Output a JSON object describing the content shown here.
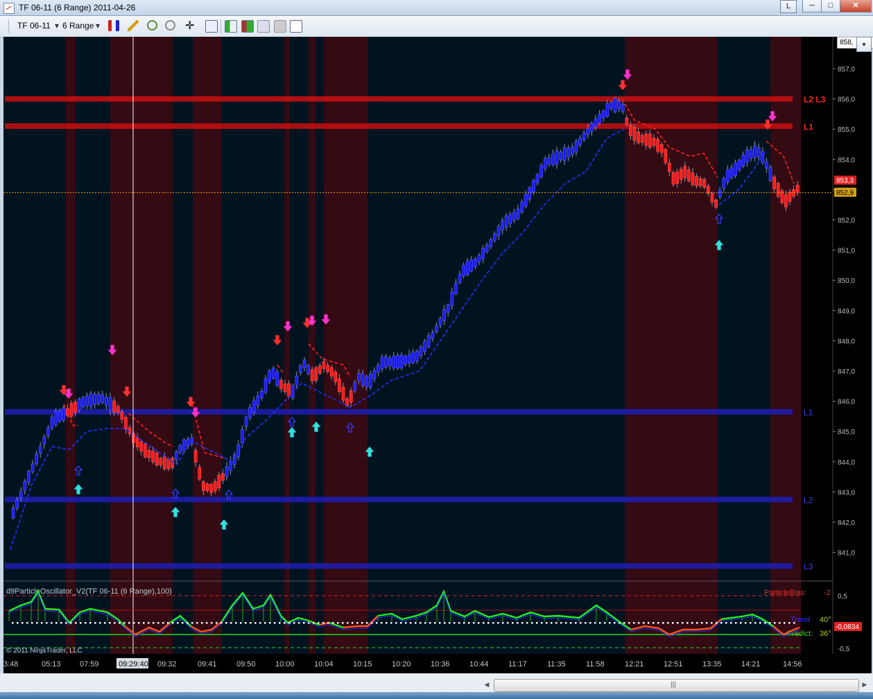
{
  "window": {
    "title": "TF 06-11 (6 Range)  2011-04-26",
    "buttons": {
      "lang": "L",
      "minimize": "─",
      "maximize": "□",
      "close": "✕"
    }
  },
  "toolbar": {
    "instrument": "TF 06-11",
    "interval": "6 Range",
    "icons": [
      "bar-type-icon",
      "pencil-icon",
      "zoom-in-icon",
      "zoom-out-icon",
      "crosshair-icon",
      "magnify-icon",
      "chart-style-icon",
      "candles-icon",
      "indicator-icon",
      "strategy-icon",
      "properties-icon"
    ]
  },
  "price_box": "858,",
  "chart": {
    "price_ticks": [
      "857,0",
      "856,0",
      "855,0",
      "854,0",
      "853,0",
      "852,0",
      "851,0",
      "850,0",
      "849,0",
      "848,0",
      "847,0",
      "846,0",
      "845,0",
      "844,0",
      "843,0",
      "842,0",
      "841,0"
    ],
    "price_current": "853,3",
    "price_last": "852,9",
    "time_ticks": [
      "3:48",
      "05:13",
      "07:59",
      "09:29:40",
      "09:32",
      "09:41",
      "09:50",
      "10:00",
      "10:04",
      "10:15",
      "10:20",
      "10:36",
      "10:44",
      "11:17",
      "11:35",
      "11:58",
      "12:21",
      "12:51",
      "13:35",
      "14:21",
      "14:56"
    ],
    "red_levels": [
      {
        "label": "L2 L3",
        "price": 856.0
      },
      {
        "label": "L1",
        "price": 855.1
      }
    ],
    "blue_levels": [
      {
        "label": "L1",
        "price": 845.65
      },
      {
        "label": "L2",
        "price": 842.75
      },
      {
        "label": "L3",
        "price": 840.55
      }
    ],
    "crosshair_time": "09:29:40",
    "colors": {
      "up": "#1a1aff",
      "down": "#ff1a1a",
      "bg": "#021320",
      "shade": "#3a0a12",
      "level_red": "#c81010",
      "level_blue": "#1f1fb4"
    }
  },
  "oscillator": {
    "title": "d9ParticleOscillator_V2(TF 06-11 (6 Range),100)",
    "particle_bias_label": "ParticleBias:",
    "particle_bias_value": "-2",
    "trend_label": "Trend",
    "trend_value": "40°",
    "predict_label": "Predict:",
    "predict_value": "36°",
    "value": "-0,0834",
    "ticks": [
      "0,5",
      "-0,5"
    ],
    "copyright": "© 2011 NinjaTrader, LLC"
  }
}
